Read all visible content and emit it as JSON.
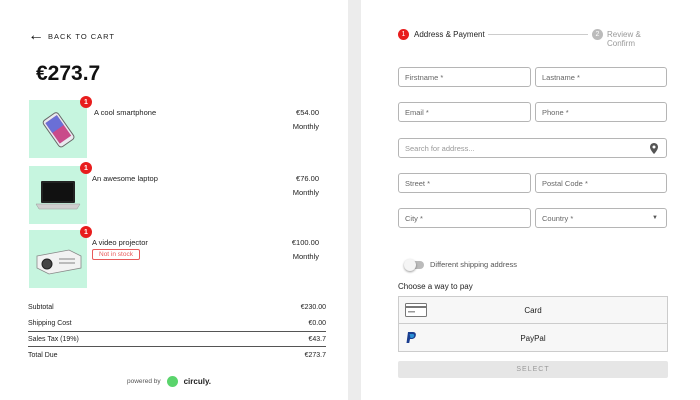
{
  "colors": {
    "accent": "#e81d1d",
    "thumb_bg": "#c6f5df",
    "brand_green": "#5ad46c",
    "stock_red": "#e85a5a"
  },
  "cart": {
    "back_label": "BACK TO CART",
    "total": "€273.7",
    "items": [
      {
        "name": "A cool smartphone",
        "price": "€54.00",
        "frequency": "Monthly",
        "qty": "1",
        "icon": "smartphone-image"
      },
      {
        "name": "An awesome laptop",
        "price": "€76.00",
        "frequency": "Monthly",
        "qty": "1",
        "icon": "laptop-image"
      },
      {
        "name": "A video projector",
        "price": "€100.00",
        "frequency": "Monthly",
        "qty": "1",
        "badge": "Not in stock",
        "icon": "projector-image"
      }
    ],
    "summary": {
      "subtotal_label": "Subtotal",
      "subtotal": "€230.00",
      "shipping_label": "Shipping Cost",
      "shipping": "€0.00",
      "tax_label": "Sales Tax (19%)",
      "tax": "€43.7",
      "total_label": "Total Due",
      "total": "€273.7"
    },
    "powered_label": "powered by",
    "brand": "circuly."
  },
  "checkout": {
    "steps": [
      {
        "num": "1",
        "label": "Address & Payment"
      },
      {
        "num": "2",
        "label": "Review & Confirm"
      }
    ],
    "fields": {
      "firstname": "Firstname *",
      "lastname": "Lastname *",
      "email": "Email *",
      "phone": "Phone *",
      "address_search": "Search for address...",
      "street": "Street *",
      "postal": "Postal Code *",
      "city": "City *",
      "country": "Country *"
    },
    "shipping_toggle_label": "Different shipping address",
    "pay_heading": "Choose a way to pay",
    "pay_options": [
      "Card",
      "PayPal"
    ],
    "select_label": "SELECT"
  }
}
